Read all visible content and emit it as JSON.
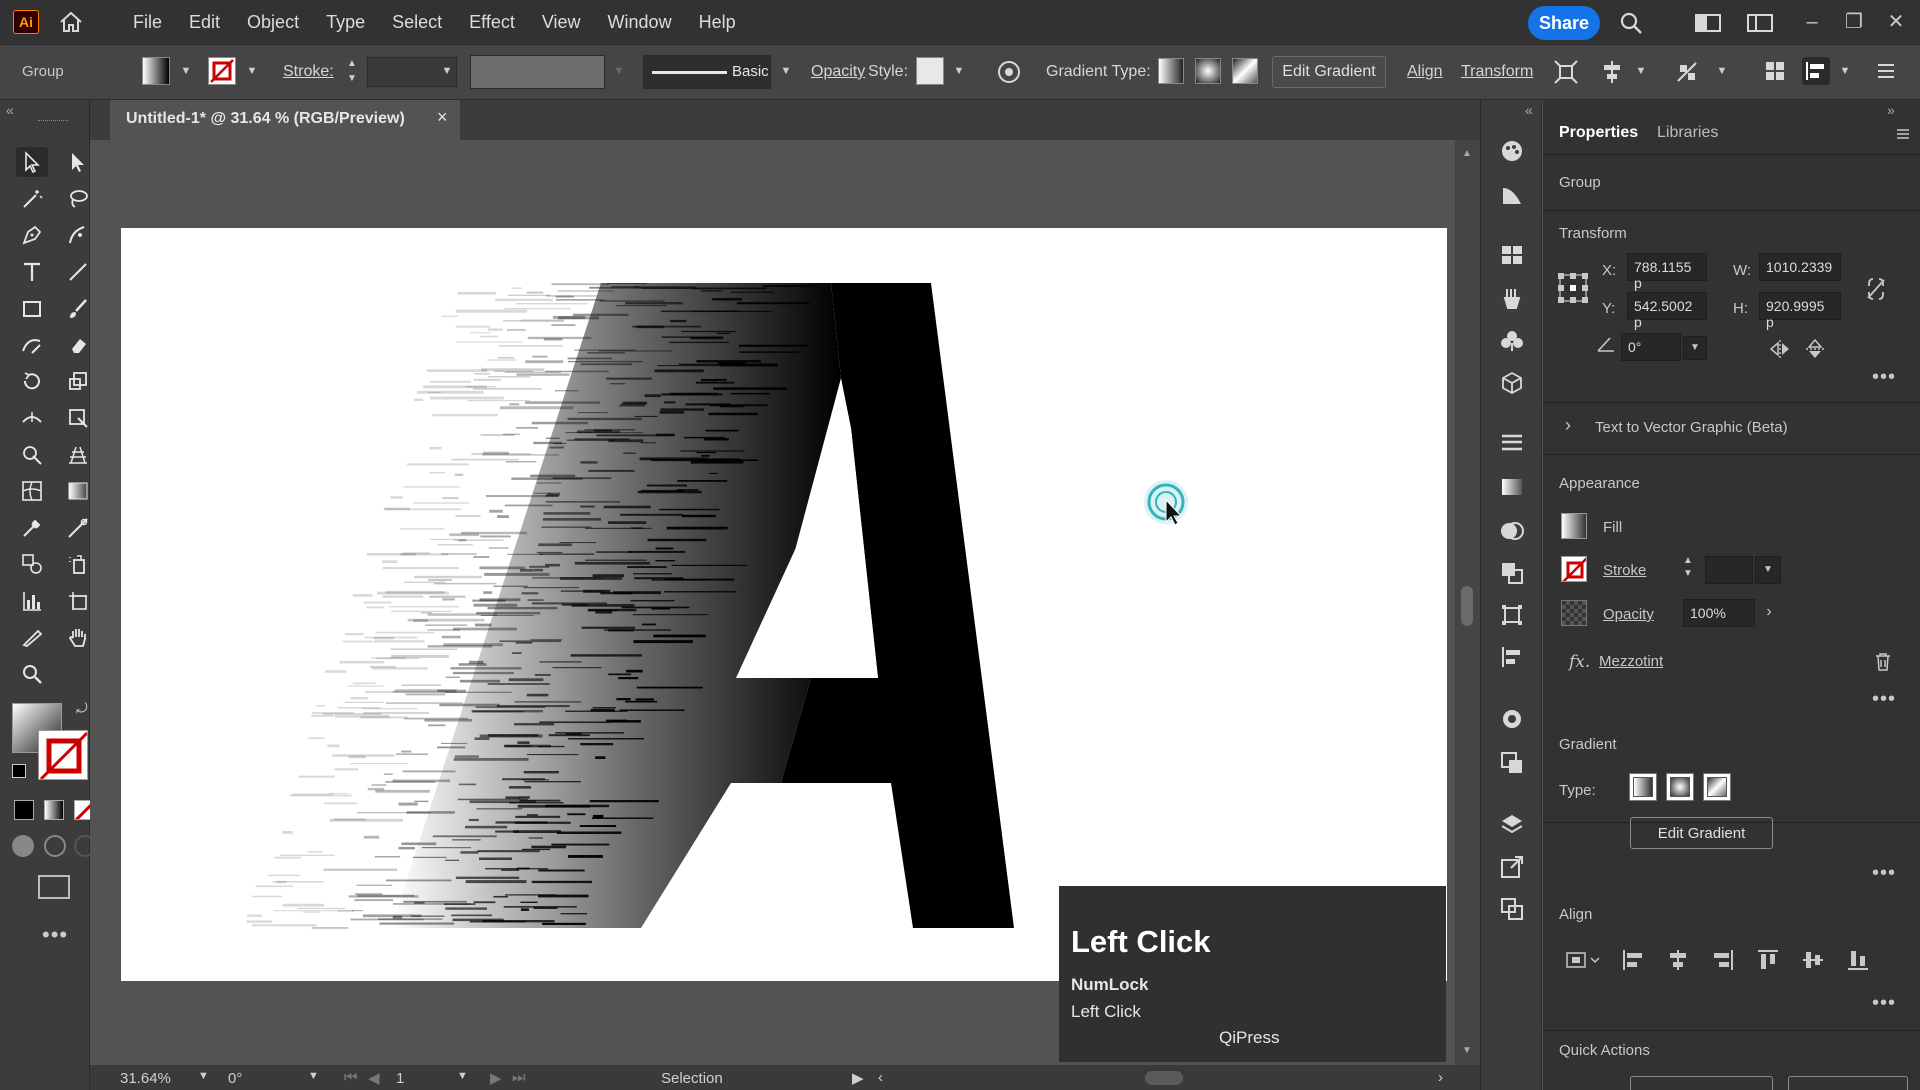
{
  "app": {
    "logo": "Ai",
    "menu": [
      "File",
      "Edit",
      "Object",
      "Type",
      "Select",
      "Effect",
      "View",
      "Window",
      "Help"
    ],
    "share_label": "Share"
  },
  "controlbar": {
    "selection_type": "Group",
    "stroke_label": "Stroke:",
    "brush_label": "Basic",
    "opacity_label": "Opacity",
    "style_label": "Style:",
    "gradient_type_label": "Gradient Type:",
    "edit_gradient_label": "Edit Gradient",
    "align_label": "Align",
    "transform_label": "Transform"
  },
  "document": {
    "tab_title": "Untitled-1* @ 31.64 % (RGB/Preview)",
    "close_glyph": "×"
  },
  "statusbar": {
    "zoom": "31.64%",
    "rotation": "0°",
    "artboard_number": "1",
    "tool_name": "Selection"
  },
  "properties": {
    "tabs": [
      "Properties",
      "Libraries"
    ],
    "selection_type": "Group",
    "transform": {
      "title": "Transform",
      "x_label": "X:",
      "x_value": "788.1155 p",
      "y_label": "Y:",
      "y_value": "542.5002 p",
      "w_label": "W:",
      "w_value": "1010.2339",
      "h_label": "H:",
      "h_value": "920.9995 p",
      "angle_value": "0°"
    },
    "text_to_vector_label": "Text to Vector Graphic (Beta)",
    "appearance": {
      "title": "Appearance",
      "fill_label": "Fill",
      "stroke_label": "Stroke",
      "opacity_label": "Opacity",
      "opacity_value": "100%",
      "effect_prefix": "fx.",
      "effect_name": "Mezzotint"
    },
    "gradient": {
      "title": "Gradient",
      "type_label": "Type:",
      "edit_button": "Edit Gradient"
    },
    "align_title": "Align",
    "quick_actions_title": "Quick Actions"
  },
  "keycast": {
    "title": "Left Click",
    "line1": "NumLock",
    "line2": "Left Click",
    "brand": "QiPress"
  },
  "colors": {
    "accent": "#1473e6",
    "menubar": "#323232",
    "panel": "#323232",
    "canvas": "#535353",
    "keycast_bg": "#303030"
  }
}
